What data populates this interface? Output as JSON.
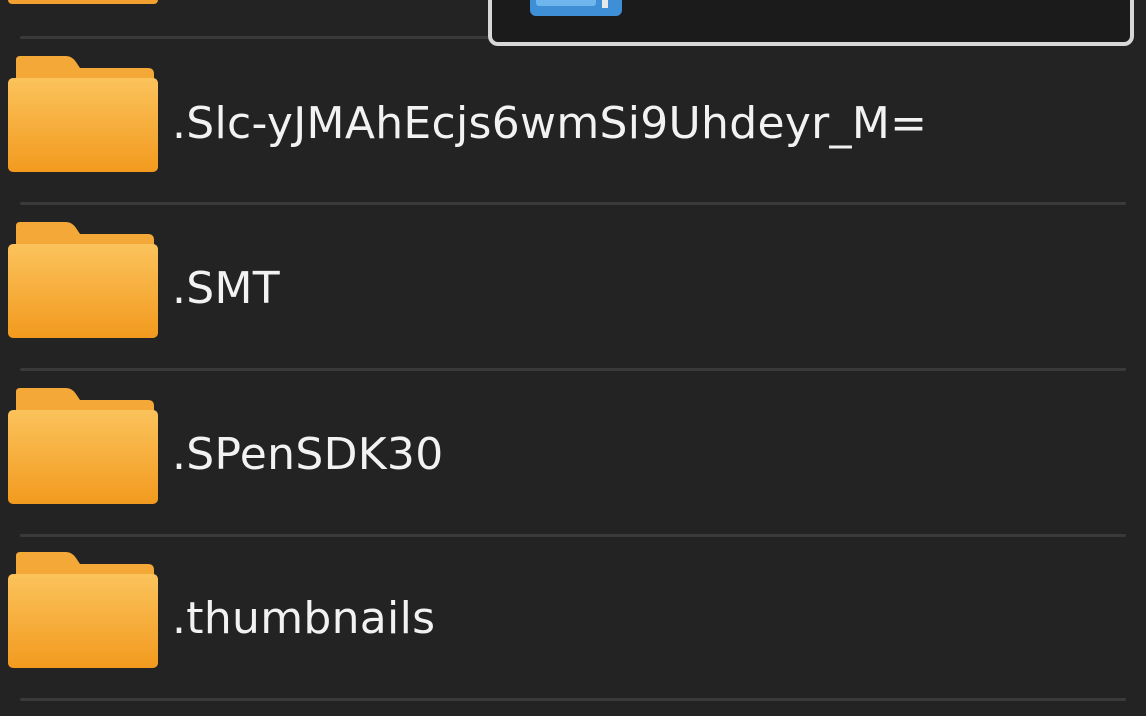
{
  "file_list": {
    "items": [
      {
        "name": ".Slc-yJMAhEcjs6wmSi9Uhdeyr_M=",
        "icon": "folder-icon"
      },
      {
        "name": ".SMT",
        "icon": "folder-icon"
      },
      {
        "name": ".SPenSDK30",
        "icon": "folder-icon"
      },
      {
        "name": ".thumbnails",
        "icon": "folder-icon"
      }
    ]
  },
  "colors": {
    "background": "#232323",
    "divider": "#3a3a3a",
    "folder_front": "#f6a623",
    "folder_back": "#e8961a",
    "label_text": "#f2f2f2",
    "popup_border": "#d8d8d8"
  },
  "popup": {
    "icon": "app-icon"
  }
}
